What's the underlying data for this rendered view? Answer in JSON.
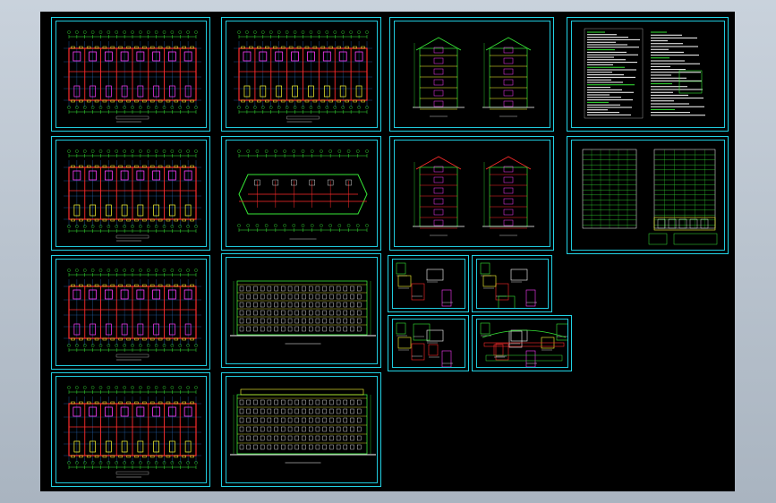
{
  "viewer": {
    "background_color": "#000000",
    "frame_color": "#22d3e6",
    "line_colors": {
      "grid": "#2f7fe0",
      "wall": "#ff2b2b",
      "dimension": "#36e636",
      "accent": "#ff3dff",
      "highlight": "#ffff33",
      "text": "#ffffff"
    }
  },
  "sheets": [
    {
      "id": "floor-plan-1",
      "kind": "floor-plan",
      "icon": "floor-plan-drawing"
    },
    {
      "id": "floor-plan-2",
      "kind": "floor-plan",
      "icon": "floor-plan-drawing"
    },
    {
      "id": "floor-plan-3",
      "kind": "floor-plan",
      "icon": "floor-plan-drawing"
    },
    {
      "id": "floor-plan-4",
      "kind": "floor-plan",
      "icon": "floor-plan-drawing"
    },
    {
      "id": "second-plan-a",
      "kind": "floor-plan",
      "icon": "floor-plan-drawing"
    },
    {
      "id": "roof-plan",
      "kind": "roof-plan",
      "icon": "roof-plan-drawing"
    },
    {
      "id": "front-elevation",
      "kind": "elevation",
      "icon": "elevation-drawing"
    },
    {
      "id": "rear-elevation",
      "kind": "elevation",
      "icon": "elevation-drawing"
    },
    {
      "id": "side-elevations",
      "kind": "elevation",
      "icon": "side-elevation-drawing"
    },
    {
      "id": "sections",
      "kind": "section",
      "icon": "section-drawing"
    },
    {
      "id": "design-notes",
      "kind": "notes",
      "icon": "text-notes"
    },
    {
      "id": "door-window-schedule",
      "kind": "schedule",
      "icon": "schedule-table"
    },
    {
      "id": "detail-stair",
      "kind": "detail",
      "icon": "detail-drawing"
    },
    {
      "id": "detail-nodes",
      "kind": "detail",
      "icon": "detail-drawing"
    },
    {
      "id": "detail-misc",
      "kind": "detail",
      "icon": "detail-drawing"
    },
    {
      "id": "detail-eaves",
      "kind": "detail",
      "icon": "detail-drawing"
    }
  ]
}
